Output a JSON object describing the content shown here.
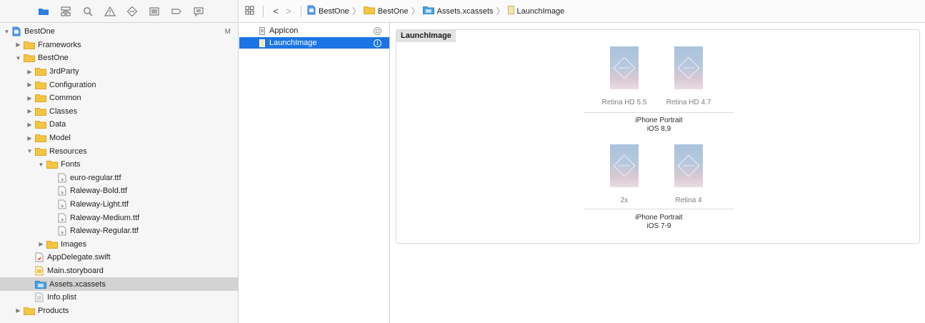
{
  "navigator": {
    "toolbar_icons": [
      "folder-icon",
      "hierarchy-icon",
      "search-icon",
      "warning-icon",
      "test-diamond-icon",
      "debug-icon",
      "breakpoint-icon",
      "report-icon"
    ],
    "tree": [
      {
        "label": "BestOne",
        "depth": 0,
        "kind": "project",
        "open": true,
        "badge": "M"
      },
      {
        "label": "Frameworks",
        "depth": 1,
        "kind": "folder",
        "open": false
      },
      {
        "label": "BestOne",
        "depth": 1,
        "kind": "folder",
        "open": true
      },
      {
        "label": "3rdParty",
        "depth": 2,
        "kind": "folder",
        "open": false
      },
      {
        "label": "Configuration",
        "depth": 2,
        "kind": "folder",
        "open": false
      },
      {
        "label": "Common",
        "depth": 2,
        "kind": "folder",
        "open": false
      },
      {
        "label": "Classes",
        "depth": 2,
        "kind": "folder",
        "open": false
      },
      {
        "label": "Data",
        "depth": 2,
        "kind": "folder",
        "open": false
      },
      {
        "label": "Model",
        "depth": 2,
        "kind": "folder",
        "open": false
      },
      {
        "label": "Resources",
        "depth": 2,
        "kind": "folder",
        "open": true
      },
      {
        "label": "Fonts",
        "depth": 3,
        "kind": "folder",
        "open": true
      },
      {
        "label": "euro-regular.ttf",
        "depth": 4,
        "kind": "file"
      },
      {
        "label": "Raleway-Bold.ttf",
        "depth": 4,
        "kind": "file"
      },
      {
        "label": "Raleway-Light.ttf",
        "depth": 4,
        "kind": "file"
      },
      {
        "label": "Raleway-Medium.ttf",
        "depth": 4,
        "kind": "file"
      },
      {
        "label": "Raleway-Regular.ttf",
        "depth": 4,
        "kind": "file"
      },
      {
        "label": "Images",
        "depth": 3,
        "kind": "folder",
        "open": false
      },
      {
        "label": "AppDelegate.swift",
        "depth": 2,
        "kind": "swift"
      },
      {
        "label": "Main.storyboard",
        "depth": 2,
        "kind": "storyboard"
      },
      {
        "label": "Assets.xcassets",
        "depth": 2,
        "kind": "xcassets",
        "selected": true
      },
      {
        "label": "Info.plist",
        "depth": 2,
        "kind": "plist"
      },
      {
        "label": "Products",
        "depth": 1,
        "kind": "folder",
        "open": false
      }
    ]
  },
  "breadcrumb": {
    "back": "<",
    "forward": ">",
    "items": [
      "BestOne",
      "BestOne",
      "Assets.xcassets",
      "LaunchImage"
    ],
    "separator": "〉"
  },
  "asset_list": {
    "items": [
      {
        "label": "AppIcon",
        "selected": false
      },
      {
        "label": "LaunchImage",
        "selected": true
      }
    ]
  },
  "editor": {
    "set_title": "LaunchImage",
    "groups": [
      {
        "slots": [
          "Retina HD 5.5",
          "Retina HD 4.7"
        ],
        "caption_line1": "iPhone Portrait",
        "caption_line2": "iOS 8,9"
      },
      {
        "slots": [
          "2x",
          "Retina 4"
        ],
        "caption_line1": "iPhone Portrait",
        "caption_line2": "iOS 7-9"
      }
    ],
    "thumb_text": "BestOne"
  },
  "colors": {
    "selection_blue": "#1b74e4",
    "folder_yellow": "#f4c542",
    "xcassets_blue": "#49a3e0"
  }
}
